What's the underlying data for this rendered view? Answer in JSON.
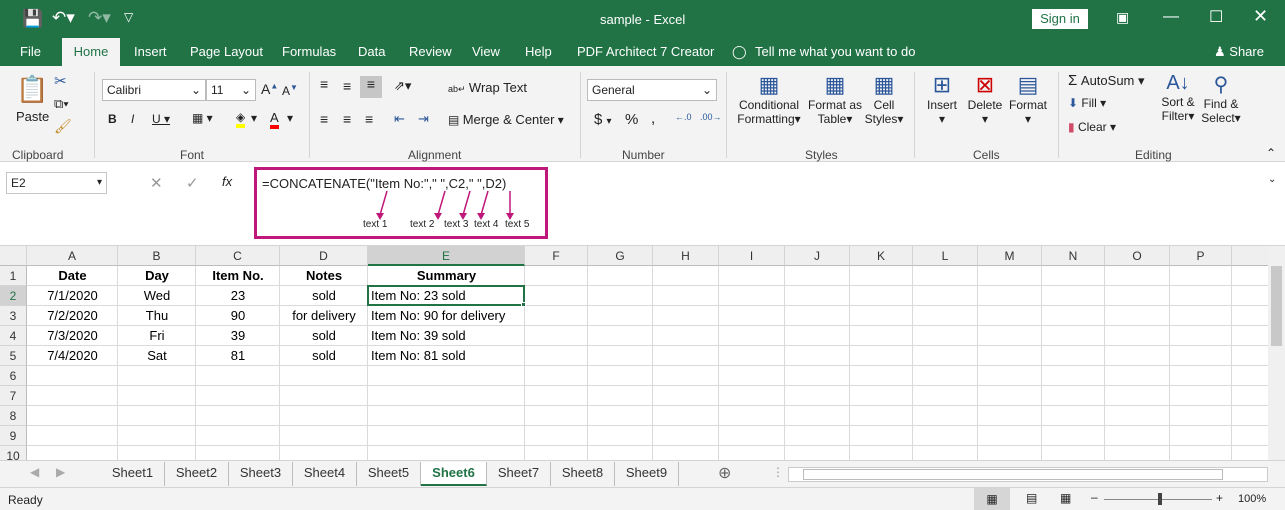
{
  "title": "sample  -  Excel",
  "signin": "Sign in",
  "tabs": [
    "File",
    "Home",
    "Insert",
    "Page Layout",
    "Formulas",
    "Data",
    "Review",
    "View",
    "Help",
    "PDF Architect 7 Creator"
  ],
  "tell_me": "Tell me what you want to do",
  "share": "Share",
  "ribbon": {
    "paste": "Paste",
    "font_name": "Calibri",
    "font_size": "11",
    "wrap_text": "Wrap Text",
    "merge_center": "Merge & Center",
    "number_format": "General",
    "conditional_formatting": [
      "Conditional",
      "Formatting"
    ],
    "format_as_table": [
      "Format as",
      "Table"
    ],
    "cell_styles": [
      "Cell",
      "Styles"
    ],
    "insert": "Insert",
    "delete": "Delete",
    "format": "Format",
    "autosum": "AutoSum",
    "fill": "Fill",
    "clear": "Clear",
    "sort_filter": [
      "Sort &",
      "Filter"
    ],
    "find_select": [
      "Find &",
      "Select"
    ],
    "groups": [
      "Clipboard",
      "Font",
      "Alignment",
      "Number",
      "Styles",
      "Cells",
      "Editing"
    ],
    "highlight_color": "#ffff00",
    "font_color": "#ff0000"
  },
  "name_box": "E2",
  "formula": "=CONCATENATE(\"Item No:\",\" \",C2,\" \",D2)",
  "annotations": [
    "text 1",
    "text 2",
    "text 3",
    "text 4",
    "text 5"
  ],
  "annotation_color": "#c0187a",
  "columns": [
    "A",
    "B",
    "C",
    "D",
    "E",
    "F",
    "G",
    "H",
    "I",
    "J",
    "K",
    "L",
    "M",
    "N",
    "O",
    "P"
  ],
  "rows": [
    "1",
    "2",
    "3",
    "4",
    "5",
    "6",
    "7",
    "8",
    "9",
    "10"
  ],
  "headers": [
    "Date",
    "Day",
    "Item No.",
    "Notes",
    "Summary"
  ],
  "data": [
    [
      "7/1/2020",
      "Wed",
      "23",
      "sold",
      "Item No: 23 sold"
    ],
    [
      "7/2/2020",
      "Thu",
      "90",
      "for delivery",
      "Item No: 90 for delivery"
    ],
    [
      "7/3/2020",
      "Fri",
      "39",
      "sold",
      "Item No: 39 sold"
    ],
    [
      "7/4/2020",
      "Sat",
      "81",
      "sold",
      "Item No: 81 sold"
    ]
  ],
  "sheets": [
    "Sheet1",
    "Sheet2",
    "Sheet3",
    "Sheet4",
    "Sheet5",
    "Sheet6",
    "Sheet7",
    "Sheet8",
    "Sheet9"
  ],
  "active_sheet": "Sheet6",
  "status": "Ready",
  "zoom": "100%"
}
